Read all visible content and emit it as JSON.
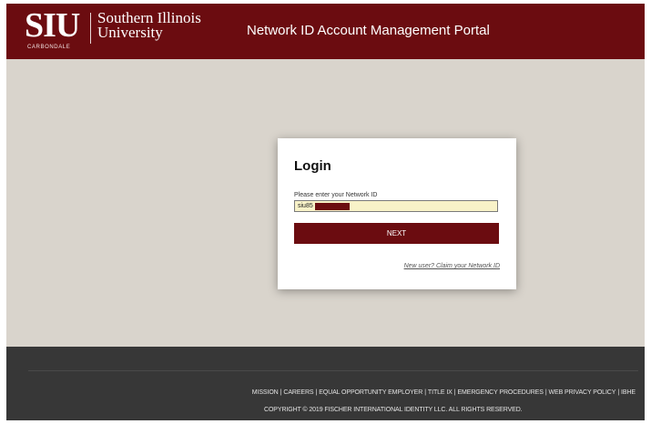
{
  "header": {
    "logo_mark": "SIU",
    "logo_line1": "Southern Illinois",
    "logo_line2": "University",
    "logo_sub": "CARBONDALE",
    "title": "Network ID Account Management Portal"
  },
  "login": {
    "heading": "Login",
    "label": "Please enter your Network ID",
    "input_value": "siu85",
    "next_label": "NEXT",
    "new_user_link": "New user? Claim your Network ID"
  },
  "footer": {
    "links": [
      "MISSION",
      "CAREERS",
      "EQUAL OPPORTUNITY EMPLOYER",
      "TITLE IX",
      "EMERGENCY PROCEDURES",
      "WEB PRIVACY POLICY",
      "IBHE"
    ],
    "separator": "|",
    "copyright": "COPYRIGHT © 2019 FISCHER INTERNATIONAL IDENTITY LLC. ALL RIGHTS RESERVED."
  },
  "colors": {
    "brand_maroon": "#6b0c10",
    "background_tan": "#d9d4cc",
    "footer_dark": "#373737",
    "input_fill": "#f8f2c8"
  }
}
